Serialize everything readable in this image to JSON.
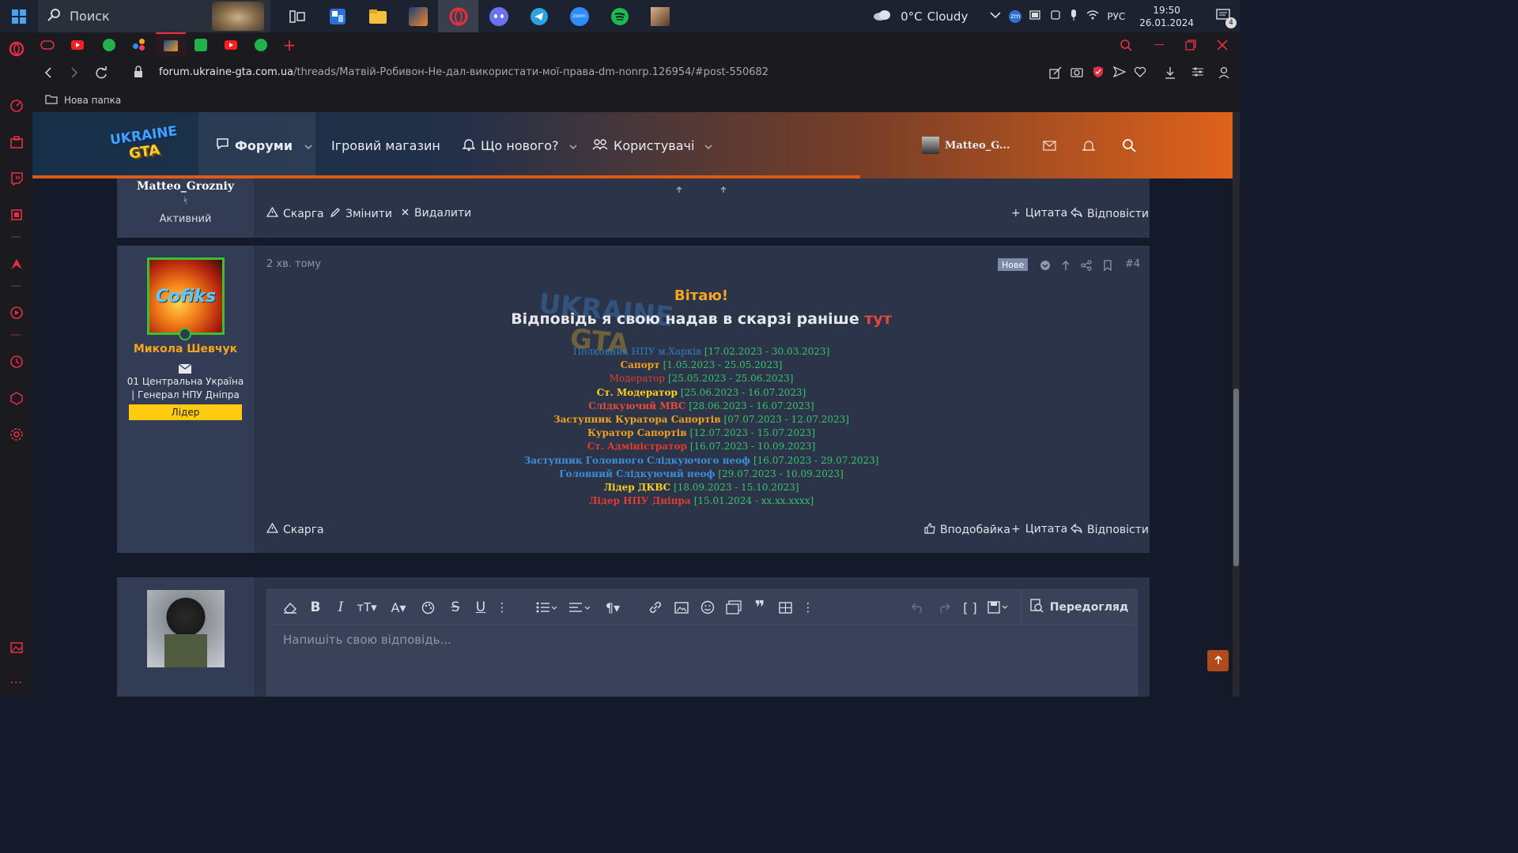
{
  "taskbar": {
    "search_label": "Поиск",
    "weather_temp": "0°C",
    "weather_desc": "Cloudy",
    "lang": "РУС",
    "time": "19:50",
    "date": "26.01.2024",
    "notif_count": "4",
    "tray_zm": "zm"
  },
  "browser": {
    "url_domain": "forum.ukraine-gta.com.ua",
    "url_path": "/threads/Матвій-Робивон-Не-дал-використати-мої-права-dm-nonrp.126954/#post-550682",
    "bookmark_folder": "Нова папка"
  },
  "forum": {
    "logo_line1": "UKRAINE",
    "logo_line2": "GTA",
    "nav": {
      "forums": "Форуми",
      "shop": "Ігровий магазин",
      "whats_new": "Що нового?",
      "users": "Користувачі",
      "username": "Matteo_G..."
    }
  },
  "post_prev": {
    "author": "Matteo_Grozniy",
    "sub_mark": "ᛋ",
    "role": "Активний",
    "actions": {
      "report": "Скарга",
      "edit": "Змінити",
      "delete": "Видалити",
      "quote": "Цитата",
      "reply": "Відповісти"
    }
  },
  "post": {
    "time": "2 хв. тому",
    "badge_new": "Нове",
    "post_num": "#4",
    "avatar_text": "Cofiks",
    "author": "Микола Шевчук",
    "user_title": "01 Центральна Україна | Генерал НПУ Дніпра",
    "banner": "Лідер",
    "greeting": "Вітаю!",
    "answer_main": "Відповідь я свою надав в скарзі раніше",
    "answer_link": "тут",
    "history": [
      {
        "title": "Полковник НПУ м.Харків",
        "dates": "[17.02.2023 - 30.03.2023]",
        "color": "#2d7fc3",
        "bold": false
      },
      {
        "title": "Сапорт",
        "dates": "[1.05.2023 - 25.05.2023]",
        "color": "#f0a21c",
        "bold": true
      },
      {
        "title": "Модератор",
        "dates": "[25.05.2023 - 25.06.2023]",
        "color": "#e23c2c",
        "bold": false
      },
      {
        "title": "Ст. Модератор",
        "dates": "[25.06.2023 - 16.07.2023]",
        "color": "#ffd21a",
        "bold": true
      },
      {
        "title": "Слідкуючий МВС",
        "dates": "[28.06.2023 - 16.07.2023]",
        "color": "#e84a3c",
        "bold": true
      },
      {
        "title": "Заступник Куратора Сапортів",
        "dates": "[07.07.2023 - 12.07.2023]",
        "color": "#f0a21c",
        "bold": true
      },
      {
        "title": "Куратор Сапортів",
        "dates": "[12.07.2023 - 15.07.2023]",
        "color": "#f0a21c",
        "bold": true
      },
      {
        "title": "Ст. Адміністратор",
        "dates": "[16.07.2023 - 10.09.2023]",
        "color": "#e23c2c",
        "bold": true
      },
      {
        "title": "Заступник Головного Слідкуючого неоф",
        "dates": "[16.07.2023 - 29.07.2023]",
        "color": "#3a8fd6",
        "bold": true
      },
      {
        "title": "Головний Слідкуючий неоф",
        "dates": "[29.07.2023 - 10.09.2023]",
        "color": "#3a8fd6",
        "bold": true
      },
      {
        "title": "Лідер ДКВС",
        "dates": "[18.09.2023 - 15.10.2023]",
        "color": "#ffd21a",
        "bold": true
      },
      {
        "title": "Лідер НПУ Дніпра",
        "dates": "[15.01.2024 - xx.xx.xxxx]",
        "color": "#e23c2c",
        "bold": true
      }
    ],
    "dates_color": "#38c26a",
    "actions": {
      "report": "Скарга",
      "like": "Вподобайка",
      "quote": "Цитата",
      "reply": "Відповісти"
    }
  },
  "editor": {
    "placeholder": "Напишіть свою відповідь...",
    "preview_label": "Передогляд"
  }
}
